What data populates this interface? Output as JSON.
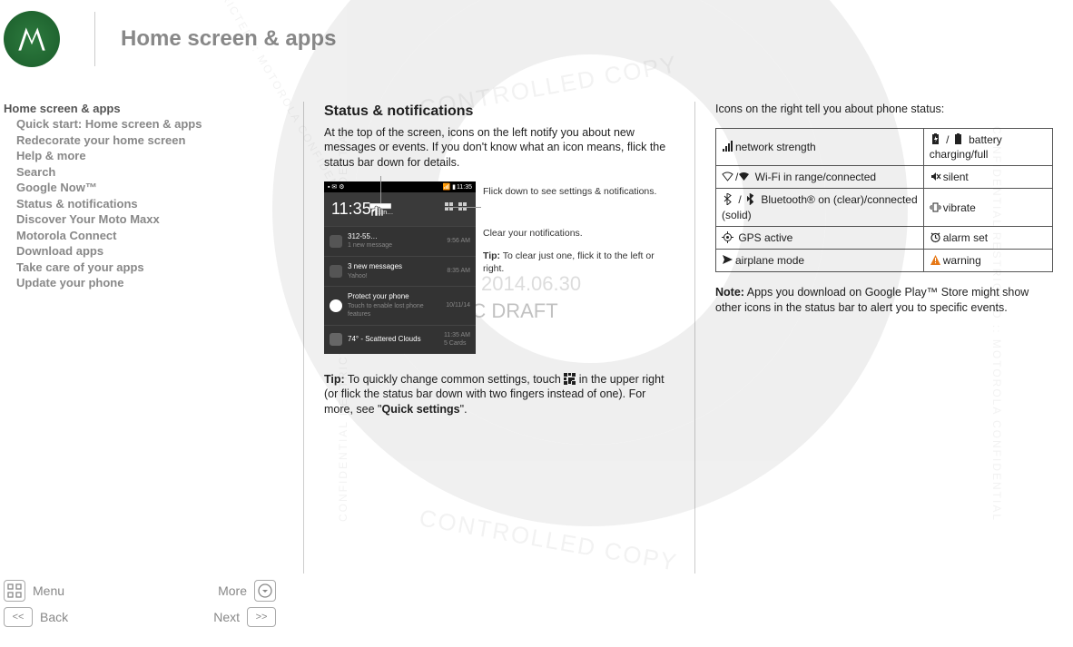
{
  "page_title": "Home screen & apps",
  "sidebar": {
    "main": "Home screen & apps",
    "items": [
      "Quick start: Home screen & apps",
      "Redecorate your home screen",
      "Help & more",
      "Search",
      "Google Now™",
      "Status & notifications",
      "Discover Your Moto Maxx",
      "Motorola Connect",
      "Download apps",
      "Take care of your apps",
      "Update your phone"
    ]
  },
  "col1": {
    "heading": "Status & notifications",
    "intro": "At the top of the screen, icons on the left notify you about new messages or events. If you don't know what an icon means, flick the status bar down for details.",
    "phone": {
      "status_time": "11:35",
      "big_time": "11:35",
      "big_time_suffix": "Sun…",
      "notifications": [
        {
          "title": "312-55…",
          "sub": "1 new message",
          "time": "9:56 AM"
        },
        {
          "title": "3 new messages",
          "sub": "Yahoo!",
          "time": "8:35 AM"
        },
        {
          "title": "Protect your phone",
          "sub": "Touch to enable lost phone features",
          "time": "10/11/14"
        },
        {
          "title": "74° - Scattered Clouds",
          "sub": "",
          "time": "11:35 AM\n5 Cards"
        }
      ]
    },
    "anno_flick": "Flick down to see settings & notifications.",
    "anno_clear": "Clear your notifications.",
    "anno_tip_label": "Tip:",
    "anno_tip_text": " To clear just one, flick it to the left or right.",
    "tip_label": "Tip:",
    "tip_text_1": " To quickly change common settings, touch ",
    "tip_text_2": " in the upper right (or flick the status bar down with two fingers instead of one). For more, see \"",
    "tip_link": "Quick settings",
    "tip_text_3": "\"."
  },
  "col2": {
    "intro": "Icons on the right tell you about phone status:",
    "table": [
      [
        {
          "icon": "signal",
          "text": "network strength"
        },
        {
          "icon": "battery-charging",
          "icon2": "battery-full",
          "sep": " / ",
          "text": " battery charging/full"
        }
      ],
      [
        {
          "icon": "wifi-outline",
          "icon2": "wifi-solid",
          "sep": "/",
          "text": " Wi-Fi in range/connected"
        },
        {
          "icon": "silent",
          "text": "silent"
        }
      ],
      [
        {
          "icon": "bt-outline",
          "icon2": "bt-solid",
          "sep": " / ",
          "text": " Bluetooth® on (clear)/connected (solid)"
        },
        {
          "icon": "vibrate",
          "text": "vibrate"
        }
      ],
      [
        {
          "icon": "gps",
          "text": " GPS active"
        },
        {
          "icon": "alarm",
          "text": "alarm set"
        }
      ],
      [
        {
          "icon": "airplane",
          "text": "airplane mode"
        },
        {
          "icon": "warning",
          "text": "warning"
        }
      ]
    ],
    "note_label": "Note:",
    "note_text": " Apps you download on Google Play™ Store might show other icons in the status bar to alert you to specific events."
  },
  "footer": {
    "menu": "Menu",
    "more": "More",
    "back": "Back",
    "next": "Next",
    "back_sym": "<<",
    "next_sym": ">>"
  },
  "watermark": {
    "draft": "FCC DRAFT",
    "date": "2014.06.30",
    "ring": "CONFIDENTIAL RESTRICTED :: MOTOROLA CONFIDENTIAL",
    "controlled": "CONTROLLED COPY"
  }
}
